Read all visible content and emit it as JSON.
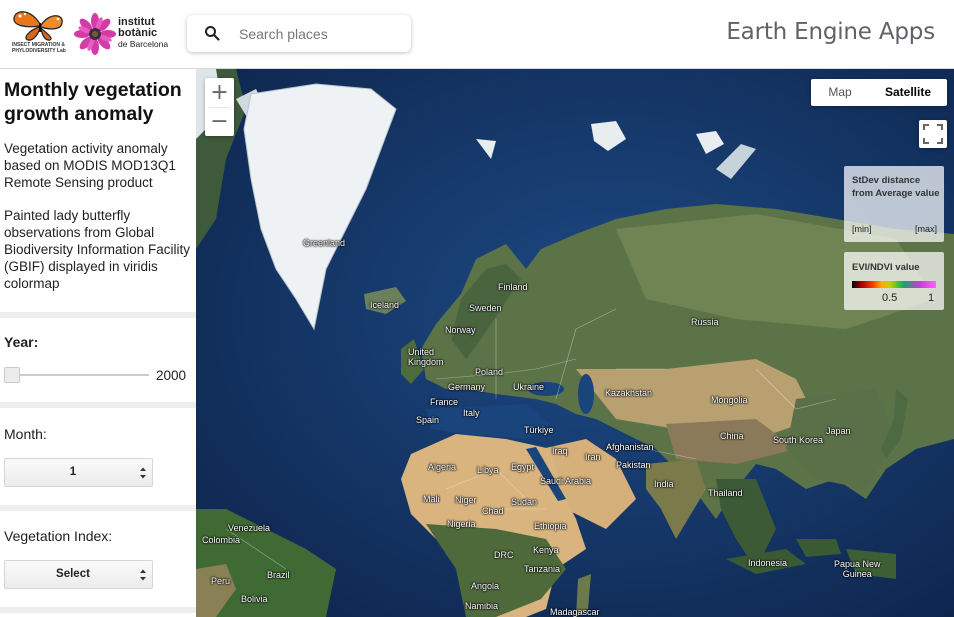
{
  "header": {
    "logo1_text": "INSECT MIGRATION &\nPHYLODIVERSITY Lab",
    "logo2_text": "institut\nbotànic",
    "logo2_sub": "de Barcelona",
    "search_placeholder": "Search places",
    "app_title": "Earth Engine Apps"
  },
  "panel": {
    "title": "Monthly vegetation growth anomaly",
    "desc1": "Vegetation activity anomaly based on MODIS MOD13Q1 Remote Sensing product",
    "desc2": "Painted lady butterfly observations from Global Biodiversity Information Facility (GBIF) displayed in viridis colormap",
    "year_label": "Year:",
    "year_value": "2000",
    "month_label": "Month:",
    "month_value": "1",
    "vi_label": "Vegetation Index:",
    "vi_value": "Select"
  },
  "map": {
    "zoom_in": "+",
    "zoom_out": "−",
    "type_map": "Map",
    "type_satellite": "Satellite",
    "selected_type": "Satellite",
    "legend1": {
      "title": "StDev distance from Average value",
      "min": "[min]",
      "max": "[max]"
    },
    "legend2": {
      "title": "EVI/NDVI value",
      "v1": "0.5",
      "v2": "1"
    },
    "labels": {
      "greenland": "Greenland",
      "iceland": "Iceland",
      "finland": "Finland",
      "sweden": "Sweden",
      "norway": "Norway",
      "russia": "Russia",
      "uk": "United\nKingdom",
      "poland": "Poland",
      "germany": "Germany",
      "ukraine": "Ukraine",
      "france": "France",
      "kazakhstan": "Kazakhstan",
      "mongolia": "Mongolia",
      "italy": "Italy",
      "spain": "Spain",
      "turkiye": "Türkiye",
      "china": "China",
      "japan": "Japan",
      "south_korea": "South Korea",
      "iraq": "Iraq",
      "iran": "Iran",
      "afghanistan": "Afghanistan",
      "pakistan": "Pakistan",
      "algeria": "Algeria",
      "libya": "Libya",
      "egypt": "Egypt",
      "saudi": "Saudi Arabia",
      "india": "India",
      "thailand": "Thailand",
      "mali": "Mali",
      "niger": "Niger",
      "chad": "Chad",
      "sudan": "Sudan",
      "nigeria": "Nigeria",
      "ethiopia": "Ethiopia",
      "venezuela": "Venezuela",
      "colombia": "Colombia",
      "drc": "DRC",
      "kenya": "Kenya",
      "tanzania": "Tanzania",
      "indonesia": "Indonesia",
      "png": "Papua New\nGuinea",
      "peru": "Peru",
      "brazil": "Brazil",
      "bolivia": "Bolivia",
      "angola": "Angola",
      "namibia": "Namibia",
      "madagascar": "Madagascar"
    }
  }
}
